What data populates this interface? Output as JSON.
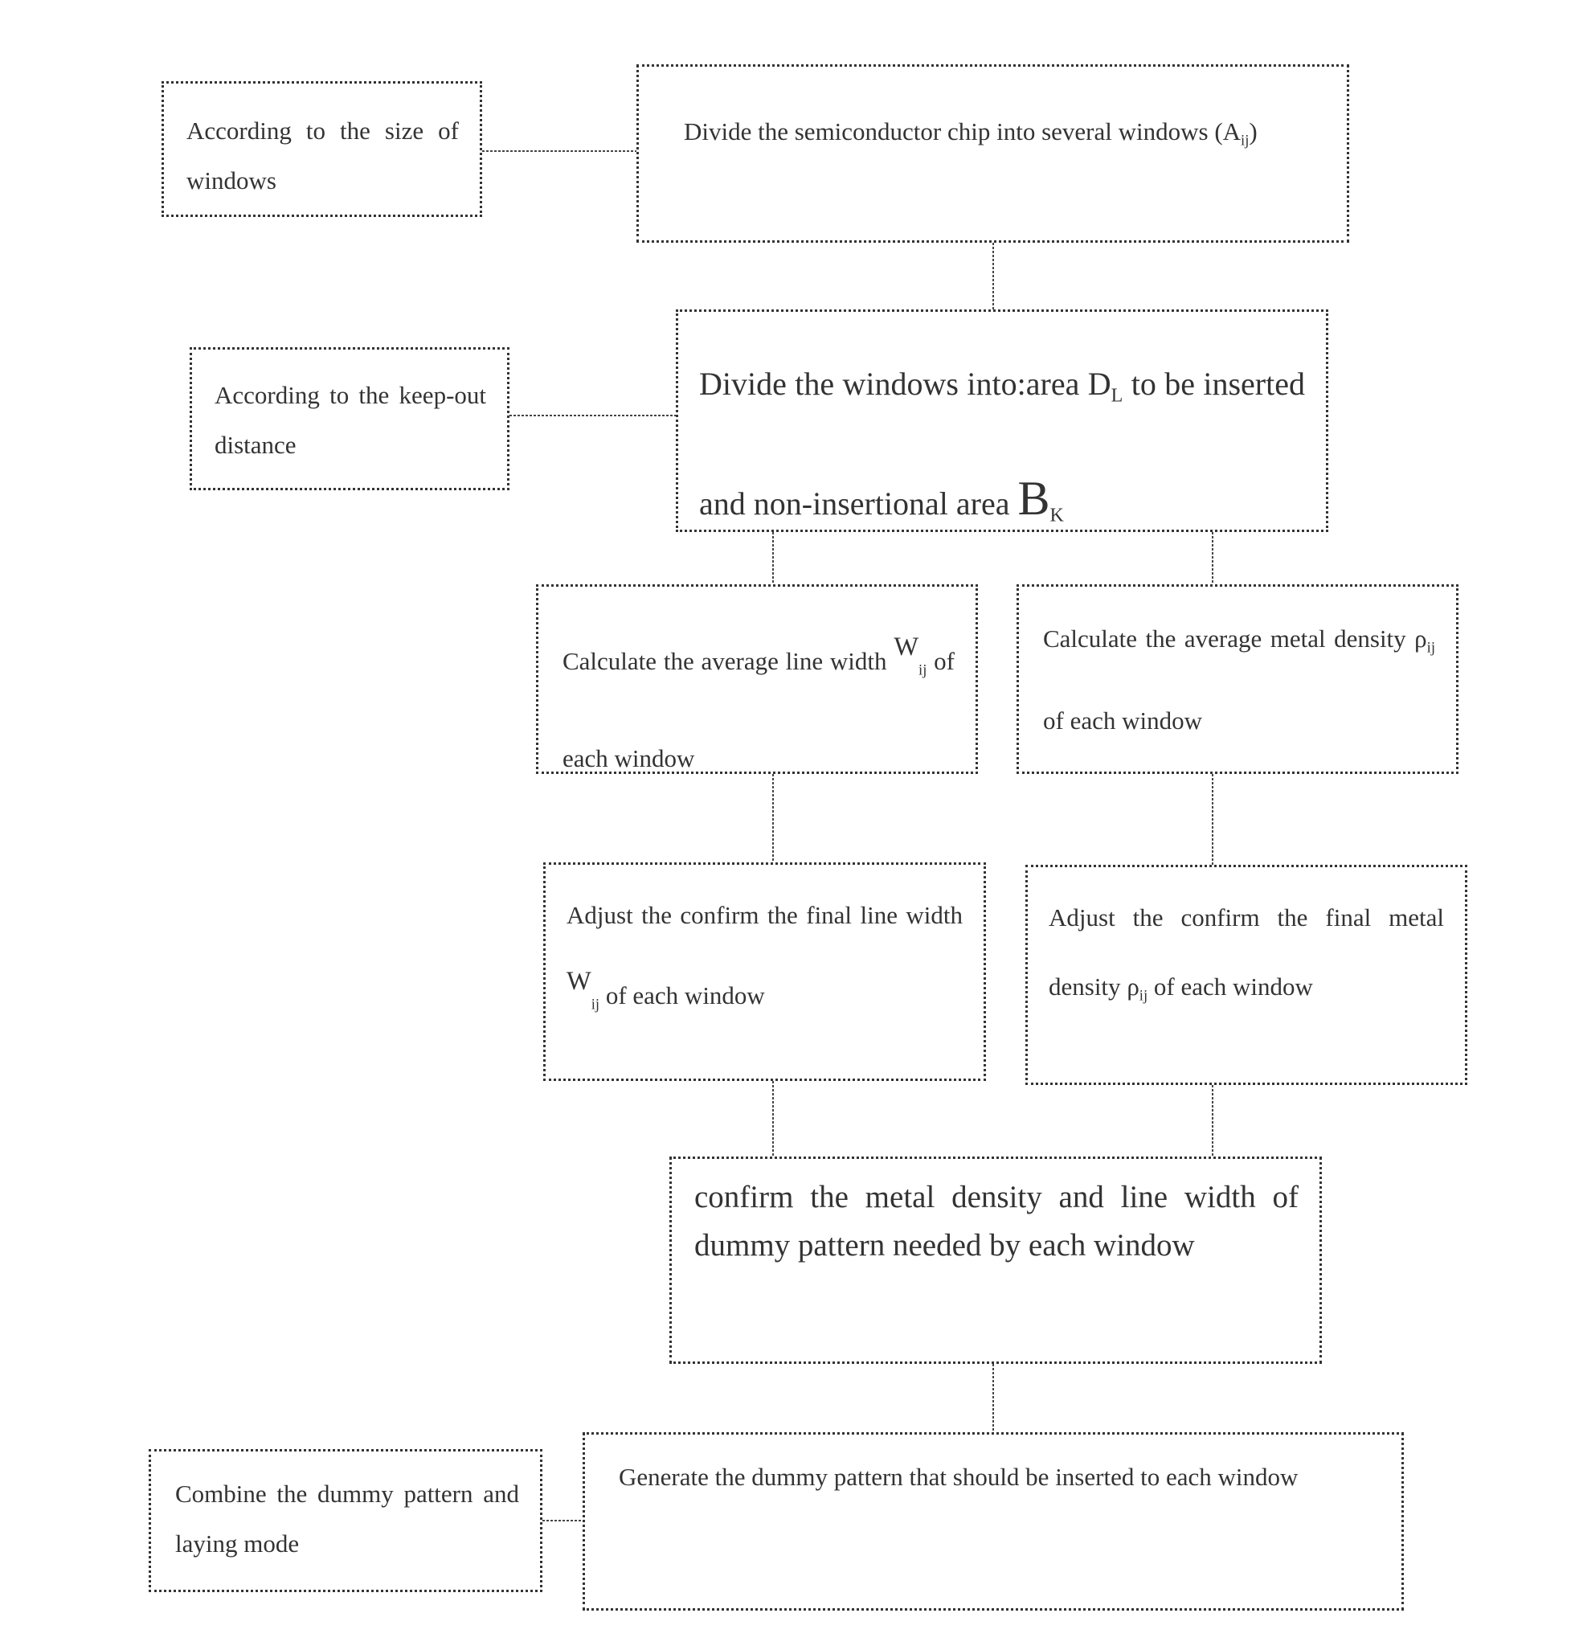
{
  "diagram": {
    "type": "flowchart",
    "nodes": {
      "size_of_windows": {
        "text": "According to the size of windows"
      },
      "divide_chip": {
        "text_before": "Divide the semiconductor chip into several windows (",
        "symbol": "A",
        "subscript": "ij",
        "text_after": ")"
      },
      "keep_out_distance": {
        "text": "According to the keep-out distance"
      },
      "divide_windows": {
        "text_before": "Divide the windows into:area ",
        "symbol_d": "D",
        "subscript_d": "L",
        "text_middle": " to be inserted and non-insertional area ",
        "symbol_b": "B",
        "subscript_b": "K"
      },
      "calc_line_width": {
        "text_before": "Calculate the average line width ",
        "symbol": "W",
        "subscript": "ij",
        "text_after": " of each window"
      },
      "calc_metal_density": {
        "text_before": "Calculate the average metal density ",
        "symbol": "ρ",
        "subscript": "ij",
        "text_after": " of each window"
      },
      "adjust_line_width": {
        "text_before": "Adjust the confirm the final line width ",
        "symbol": "W",
        "subscript": "ij",
        "text_after": " of each window"
      },
      "adjust_metal_density": {
        "text_before": "Adjust the confirm the final metal density ",
        "symbol": "ρ",
        "subscript": "ij",
        "text_after": " of each window"
      },
      "confirm_dummy": {
        "text": "confirm the metal density and line width of dummy pattern needed by each window"
      },
      "combine_dummy": {
        "text": "Combine the dummy pattern and laying mode"
      },
      "generate_dummy": {
        "text": "Generate the dummy pattern that should be inserted to each window"
      }
    },
    "edges": [
      [
        "size_of_windows",
        "divide_chip"
      ],
      [
        "divide_chip",
        "divide_windows"
      ],
      [
        "keep_out_distance",
        "divide_windows"
      ],
      [
        "divide_windows",
        "calc_line_width"
      ],
      [
        "divide_windows",
        "calc_metal_density"
      ],
      [
        "calc_line_width",
        "adjust_line_width"
      ],
      [
        "calc_metal_density",
        "adjust_metal_density"
      ],
      [
        "adjust_line_width",
        "confirm_dummy"
      ],
      [
        "adjust_metal_density",
        "confirm_dummy"
      ],
      [
        "confirm_dummy",
        "generate_dummy"
      ],
      [
        "combine_dummy",
        "generate_dummy"
      ]
    ]
  }
}
